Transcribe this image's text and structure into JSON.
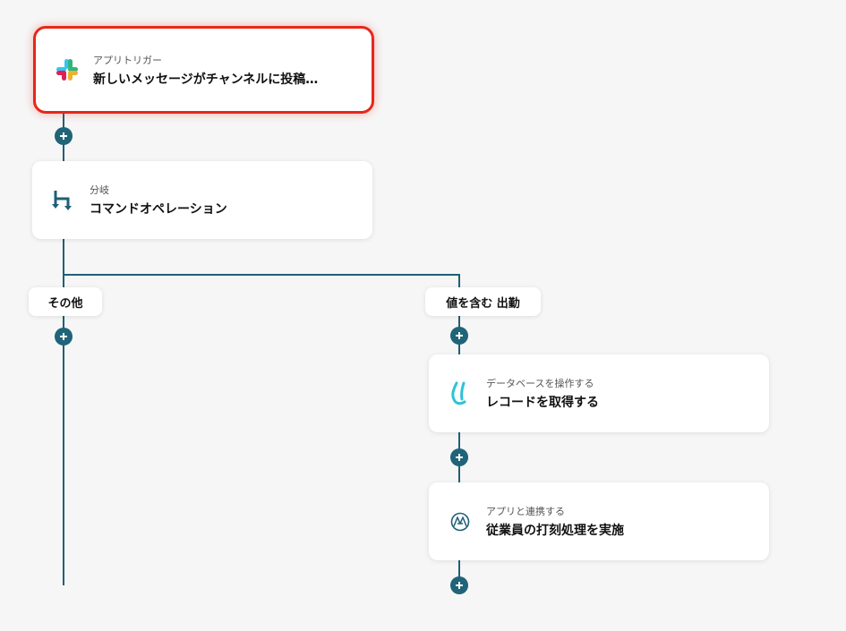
{
  "nodes": {
    "trigger": {
      "sub": "アプリトリガー",
      "title": "新しいメッセージがチャンネルに投稿…",
      "icon": "slack-icon"
    },
    "branch": {
      "sub": "分岐",
      "title": "コマンドオペレーション",
      "icon": "branch-icon"
    },
    "db": {
      "sub": "データベースを操作する",
      "title": "レコードを取得する",
      "icon": "database-icon"
    },
    "app": {
      "sub": "アプリと連携する",
      "title": "従業員の打刻処理を実施",
      "icon": "app-link-icon"
    }
  },
  "branches": {
    "other": {
      "label": "その他"
    },
    "contains": {
      "label": "値を含む 出勤"
    }
  },
  "colors": {
    "line": "#1f5f78",
    "selected_border": "#e5281a",
    "db_icon": "#2bc3d6"
  }
}
